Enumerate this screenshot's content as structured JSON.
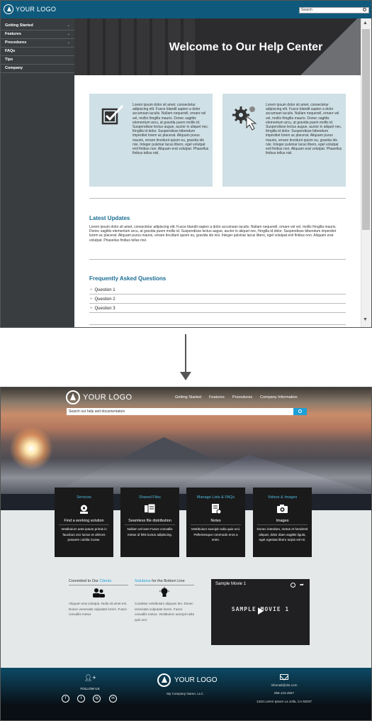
{
  "before": {
    "header": {
      "logo_text": "YOUR LOGO",
      "search_placeholder": "Search"
    },
    "sidebar": {
      "items": [
        {
          "label": "Getting Started",
          "expandable": true
        },
        {
          "label": "Features",
          "expandable": true
        },
        {
          "label": "Procedures",
          "expandable": true
        },
        {
          "label": "FAQs",
          "expandable": false
        },
        {
          "label": "Tips",
          "expandable": false
        },
        {
          "label": "Company",
          "expandable": false
        }
      ]
    },
    "hero": {
      "title": "Welcome to Our Help Center"
    },
    "cards": [
      {
        "icon": "checkbox-icon",
        "text": "Lorem ipsum dolor sit amet, consectetur adipiscing elit. Fusce blandit sapien a dolor accumsan iaculis. Nullam nequerell, ornare vel vel, mollis fringilla mauris. Donec sagittis elementum arcu, at gravida puem mollis id. Suspendisse lectus augue, auctor in aliquet nec, fringilla id dolor. Suspendisse bibendum imperdiet lorem ac placerat. Aliquam purus mauris, ornare tincidunt quism eu, gravida ids nisi. Integer pulvinar lacus libero, egel volutpat enil finibus non. Aliquam erat volutpat. Phasellus finibus tellus nisl."
      },
      {
        "icon": "gears-cursor-icon",
        "text": "Lorem ipsum dolor sit amet, consectetur adipiscing elit. Fusce blandit sapien a dolor accumsan iaculis. Nullam nequerell, ornare vel vel, mollis fringilla mauris. Donec sagittis elementum arcu, at gravida puem mollis id. Suspendisse lectus augue, auctor in aliquet nec, fringilla id dolor. Suspendisse bibendum imperdiet lorem ac placerat. Aliquam purus mauris, ornare tincidunt quism eu, gravida ids nisi. Integer pulvinar lacus libero, egel volutpat enil finibus non. Aliquam erat volutpat. Phasellus finibus tellus nisl."
      }
    ],
    "updates": {
      "heading": "Latest Updates",
      "body": "Lorem ipsum dolor sit amet, consectetur adipiscing elit. Fusce blandit sapien a dolor accumsan iaculis. Nullam nequerell, ornare vel vel, mollis fringilla mauris. Donec sagittis elementum arcu, at gravida puem mollis id. Suspendisse lectus augue, auctor in aliquet nec, fringilla id dolor. Suspendisse bibendum imperdiet lorem ac placerat. Aliquam purus mauris, ornare tincidunt quism eu, gravida ids nisi. Integer pulvinar lacus libero, egel volutpat enil finibus non. Aliquam erat volutpat. Phasellus finibus tellus nisl."
    },
    "faq": {
      "heading": "Frequently Asked Questions",
      "questions": [
        "Question 1",
        "Question 2",
        "Question 3"
      ]
    },
    "colors": {
      "header": "#0f5a7c",
      "sidebar": "#3a3d3f",
      "card": "#cfe0e6",
      "accent": "#1a6d94"
    }
  },
  "after": {
    "header": {
      "logo_text": "YOUR LOGO",
      "nav": [
        "Getting Started",
        "Features",
        "Procedures",
        "Company Information"
      ],
      "search_placeholder": "Search our help and documentation"
    },
    "cards": [
      {
        "title": "Services",
        "icon": "gear-hand-icon",
        "subtitle": "Find a working solution",
        "text": "Vestibulum ante ipsum primis in faucibus orci luctus et ultrices posuere cubilia Curae."
      },
      {
        "title": "Shared Files",
        "icon": "files-icon",
        "subtitle": "Seamless file distribution",
        "text": "Nullam vel sem Fusce convallis metus id felis luctus adipiscing."
      },
      {
        "title": "Manage Lists & FAQs",
        "icon": "list-icon",
        "subtitle": "Notes",
        "text": "Vestibulum suscipit nulla quis orci. Pellentesque commodo eros a enim."
      },
      {
        "title": "Videos & Images",
        "icon": "camera-icon",
        "subtitle": "Images",
        "text": "Donec interdum, metus et hendrerit aliquet, dolor diam sagittis ligula, eget egestas libero turpis vel mi."
      }
    ],
    "columns": [
      {
        "heading_pre": "Commited to Our ",
        "heading_accent": "Clients",
        "heading_post": "",
        "icon": "people-icon",
        "text": "Aliquam erat volutpat. Nulla sit amet est. Donec venenatis vulputate lorem. Fusce convallis metus"
      },
      {
        "heading_pre": "",
        "heading_accent": "Solutions",
        "heading_post": " for the Bottom Line",
        "icon": "lightbulb-icon",
        "text": "Curabitur vestibulum aliquam leo. Donec venenatis vulputate lorem. Fusce convallis metus. Vestibulum suscipit nulla quis orci."
      }
    ],
    "video": {
      "title": "Sample Movie 1",
      "overlay": "SAMPLE MOVIE 1"
    },
    "footer": {
      "follow_label": "FOLLOW US",
      "social": [
        "f",
        "t",
        "ig",
        "in"
      ],
      "logo_text": "YOUR LOGO",
      "company": "My Company Name, LLC",
      "email": "infomail@dot.com",
      "phone": "858.123.4567",
      "address": "1234 Lorem Ipsum La Jolla, CA 92037"
    },
    "colors": {
      "accent": "#1da0d8",
      "card": "#1a1a1a",
      "footer_top": "#0c4a66"
    }
  }
}
